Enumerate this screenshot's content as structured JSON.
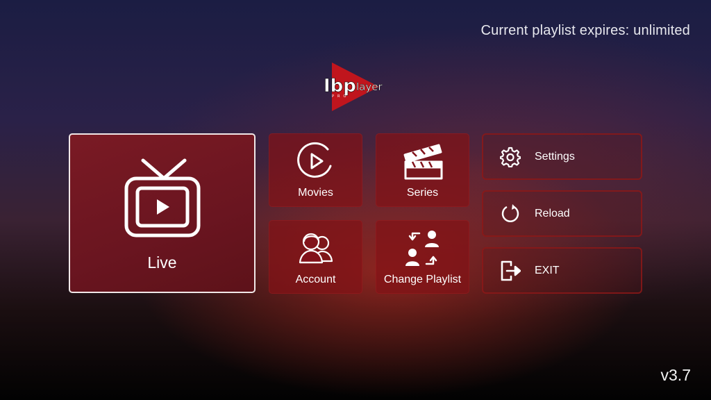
{
  "header": {
    "expiry_text": "Current playlist expires: unlimited"
  },
  "logo": {
    "text_prefix": "Ibp",
    "text_suffix": "layer",
    "sub_text": "PRO",
    "accent_color": "#c0151d"
  },
  "menu": {
    "live_label": "Live",
    "movies_label": "Movies",
    "series_label": "Series",
    "account_label": "Account",
    "change_playlist_label": "Change Playlist"
  },
  "side_menu": {
    "settings_label": "Settings",
    "reload_label": "Reload",
    "exit_label": "EXIT"
  },
  "footer": {
    "version": "v3.7"
  },
  "icons": {
    "live": "tv-icon",
    "movies": "play-circle-icon",
    "series": "clapperboard-icon",
    "account": "users-icon",
    "change_playlist": "swap-users-icon",
    "settings": "gear-icon",
    "reload": "reload-icon",
    "exit": "exit-icon"
  },
  "colors": {
    "tile_red": "#82121a",
    "live_border": "#f1e8e8",
    "side_border": "#8c1919"
  }
}
